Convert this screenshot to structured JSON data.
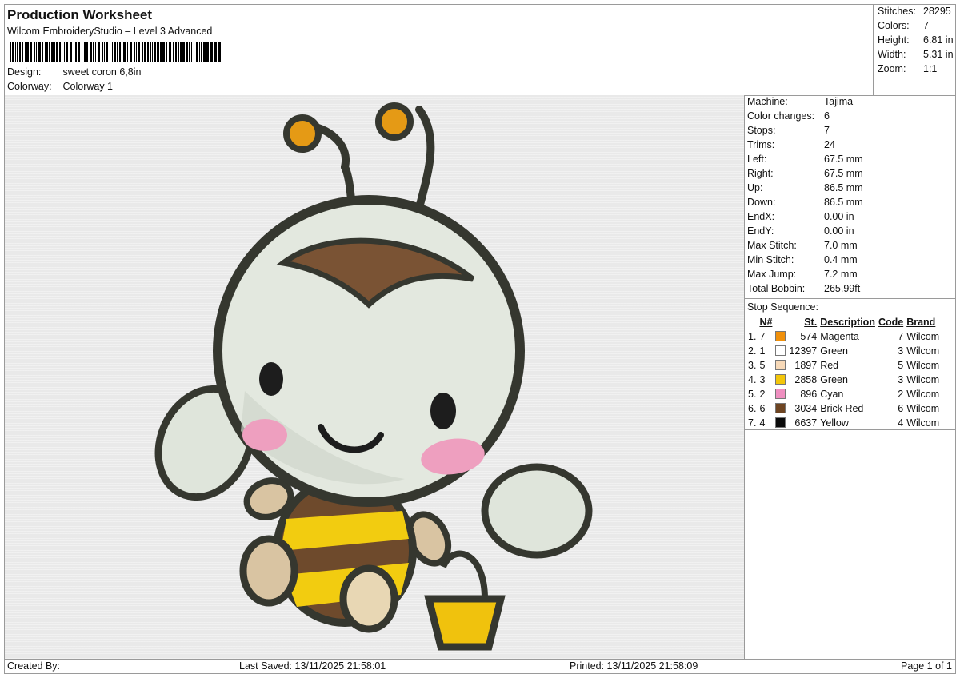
{
  "header": {
    "title": "Production Worksheet",
    "software": "Wilcom EmbroideryStudio – Level 3 Advanced",
    "design_label": "Design:",
    "design_value": "sweet coron 6,8in",
    "colorway_label": "Colorway:",
    "colorway_value": "Colorway 1"
  },
  "stats": [
    {
      "label": "Stitches:",
      "value": "28295"
    },
    {
      "label": "Colors:",
      "value": "7"
    },
    {
      "label": "Height:",
      "value": "6.81 in"
    },
    {
      "label": "Width:",
      "value": "5.31 in"
    },
    {
      "label": "Zoom:",
      "value": "1:1"
    }
  ],
  "machine_info": [
    {
      "label": "Machine:",
      "value": "Tajima"
    },
    {
      "label": "Color changes:",
      "value": "6"
    },
    {
      "label": "Stops:",
      "value": "7"
    },
    {
      "label": "Trims:",
      "value": "24"
    },
    {
      "label": "Left:",
      "value": "67.5 mm"
    },
    {
      "label": "Right:",
      "value": "67.5 mm"
    },
    {
      "label": "Up:",
      "value": "86.5 mm"
    },
    {
      "label": "Down:",
      "value": "86.5 mm"
    },
    {
      "label": "EndX:",
      "value": "0.00 in"
    },
    {
      "label": "EndY:",
      "value": "0.00 in"
    },
    {
      "label": "Max Stitch:",
      "value": "7.0 mm"
    },
    {
      "label": "Min Stitch:",
      "value": "0.4 mm"
    },
    {
      "label": "Max Jump:",
      "value": "7.2 mm"
    },
    {
      "label": "Total Bobbin:",
      "value": "265.99ft"
    }
  ],
  "stop_sequence": {
    "title": "Stop Sequence:",
    "headers": {
      "n": "N#",
      "st": "St.",
      "description": "Description",
      "code": "Code",
      "brand": "Brand"
    },
    "rows": [
      {
        "idx": "1.",
        "n": "7",
        "color": "#f0900a",
        "st": "574",
        "description": "Magenta",
        "code": "7",
        "brand": "Wilcom"
      },
      {
        "idx": "2.",
        "n": "1",
        "color": "#ffffff",
        "st": "12397",
        "description": "Green",
        "code": "3",
        "brand": "Wilcom"
      },
      {
        "idx": "3.",
        "n": "5",
        "color": "#f7d9b8",
        "st": "1897",
        "description": "Red",
        "code": "5",
        "brand": "Wilcom"
      },
      {
        "idx": "4.",
        "n": "3",
        "color": "#f3c60a",
        "st": "2858",
        "description": "Green",
        "code": "3",
        "brand": "Wilcom"
      },
      {
        "idx": "5.",
        "n": "2",
        "color": "#ef8fc0",
        "st": "896",
        "description": "Cyan",
        "code": "2",
        "brand": "Wilcom"
      },
      {
        "idx": "6.",
        "n": "6",
        "color": "#6e4522",
        "st": "3034",
        "description": "Brick Red",
        "code": "6",
        "brand": "Wilcom"
      },
      {
        "idx": "7.",
        "n": "4",
        "color": "#0a0a0a",
        "st": "6637",
        "description": "Yellow",
        "code": "4",
        "brand": "Wilcom"
      }
    ]
  },
  "footer": {
    "created_by": "Created By:",
    "last_saved": "Last Saved: 13/11/2025 21:58:01",
    "printed": "Printed: 13/11/2025 21:58:09",
    "page": "Page 1 of 1"
  }
}
